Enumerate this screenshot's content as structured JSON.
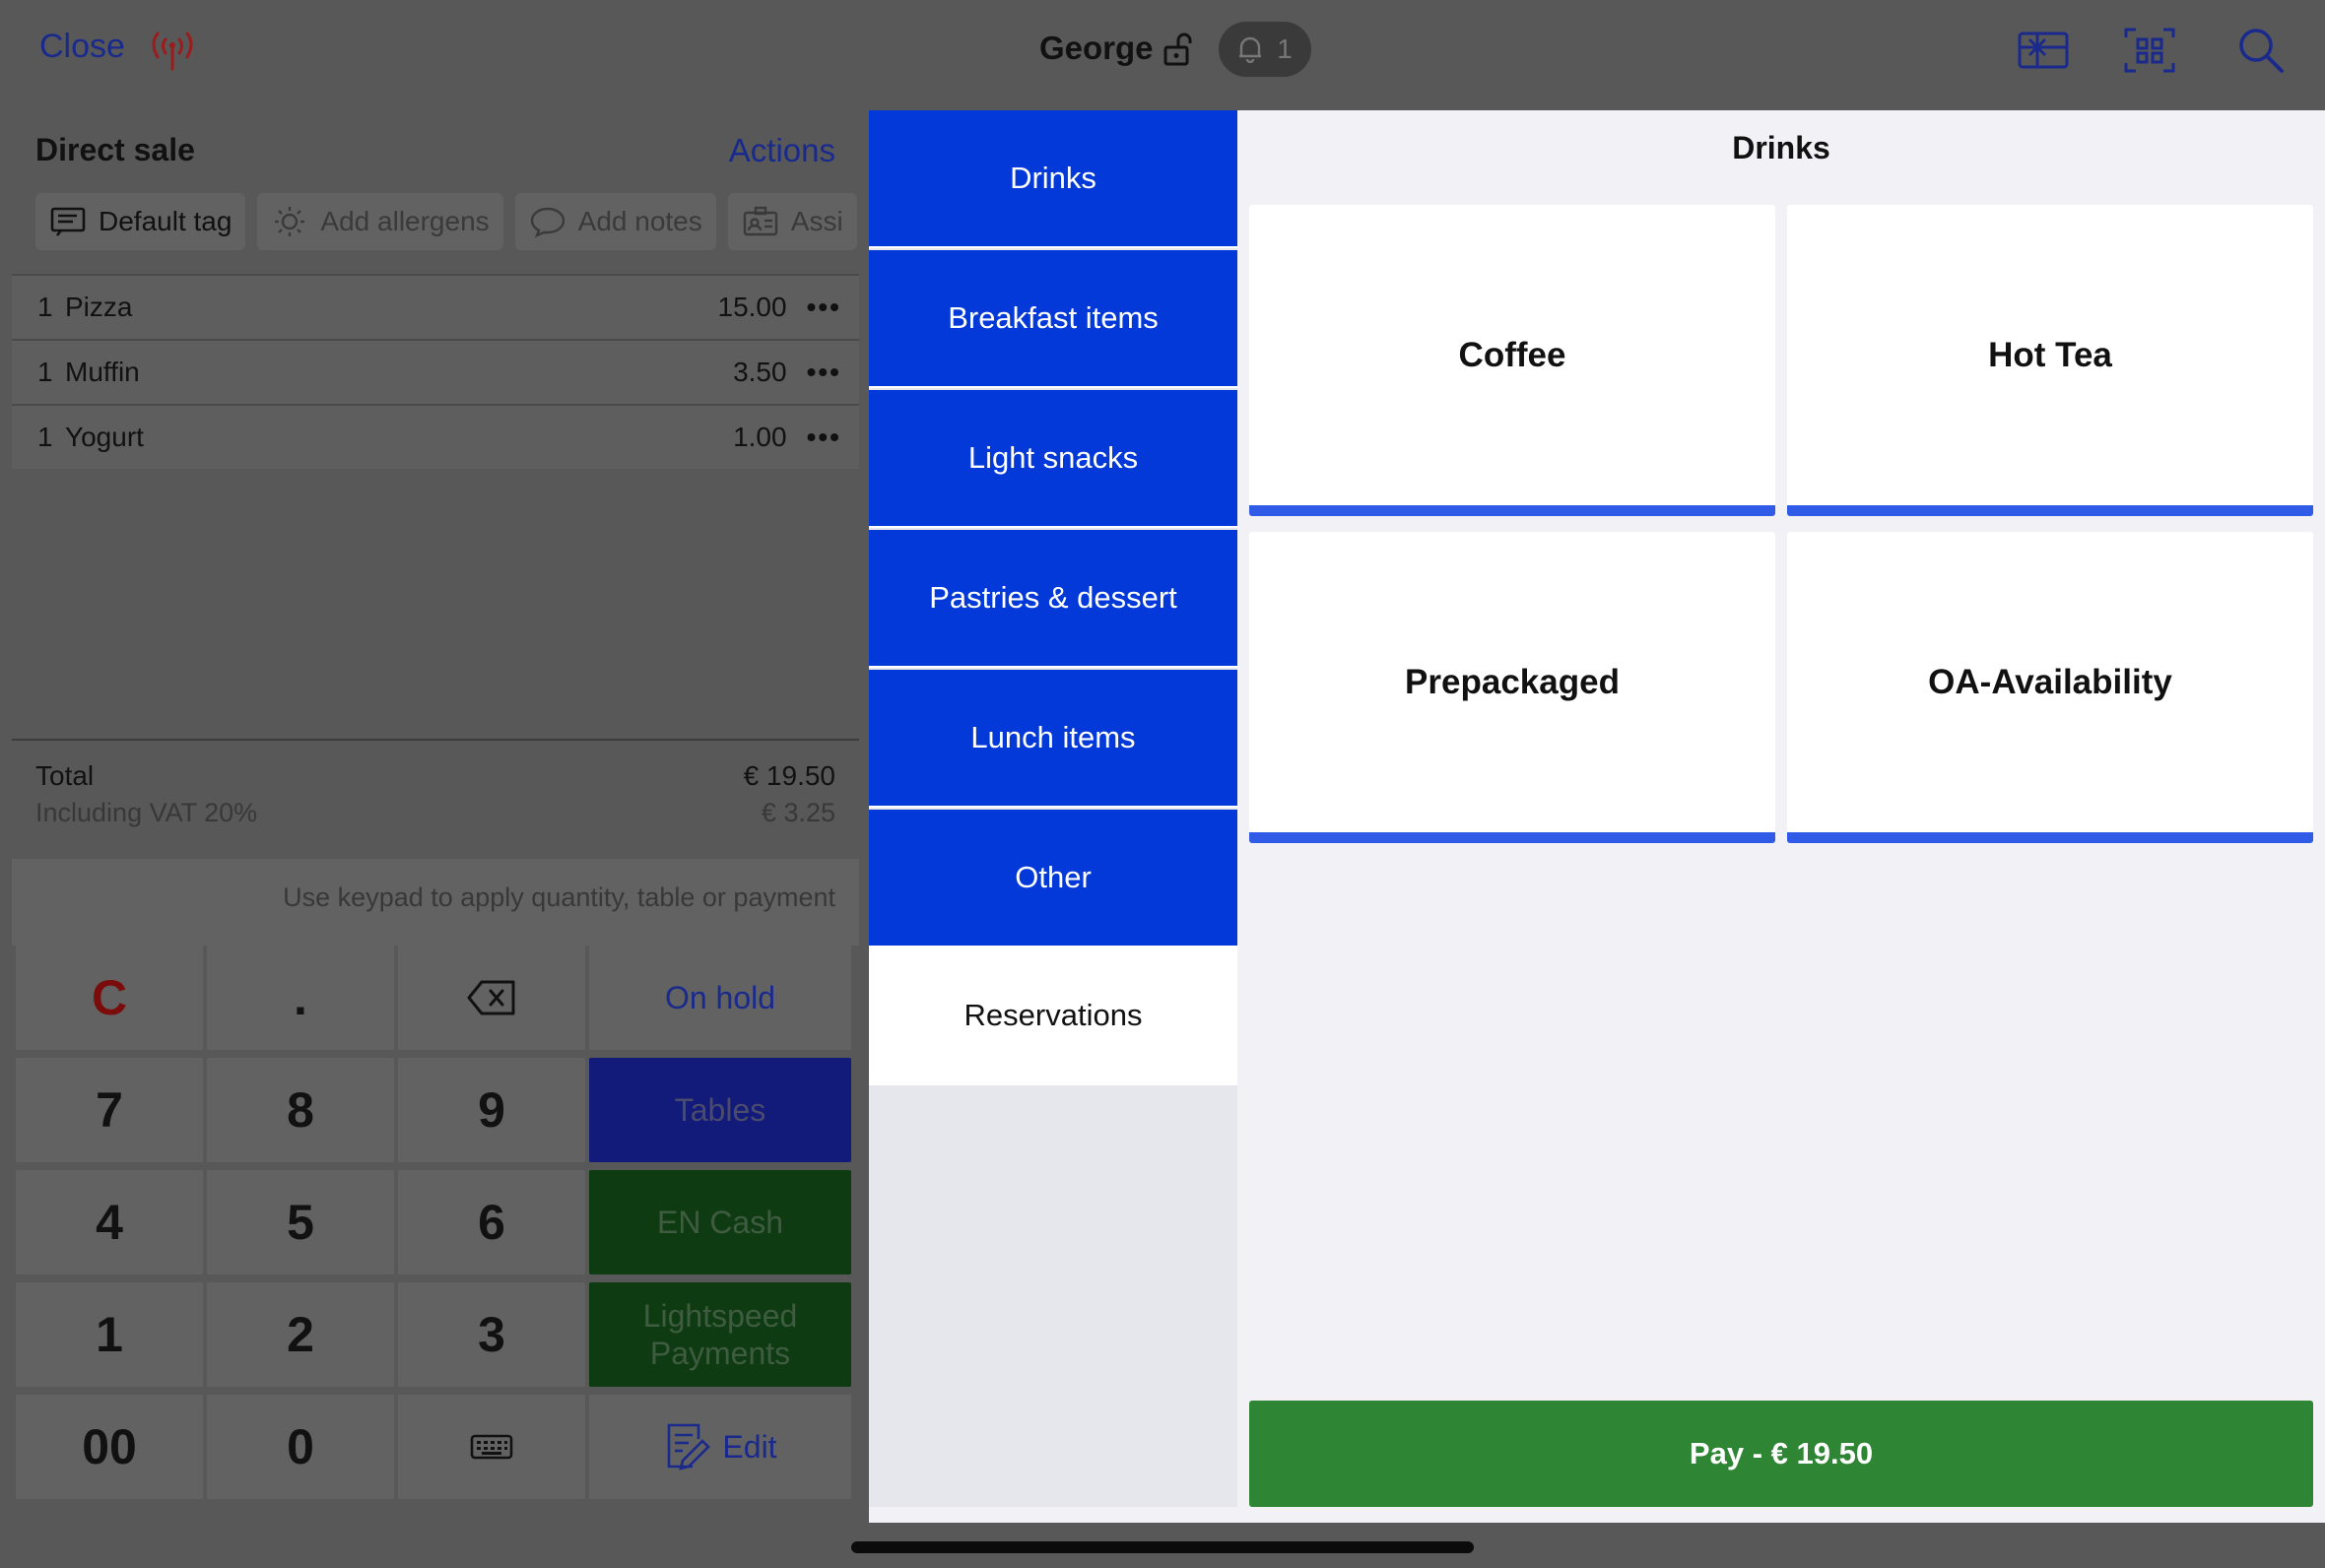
{
  "topbar": {
    "close_label": "Close",
    "user_name": "George",
    "notification_count": "1",
    "icons": [
      "signal-icon",
      "lock-icon",
      "bell-icon",
      "gift-card-icon",
      "qr-scan-icon",
      "search-icon"
    ]
  },
  "order": {
    "title": "Direct sale",
    "actions_label": "Actions",
    "tags": [
      {
        "label": "Default tag",
        "icon": "tag-list-icon"
      },
      {
        "label": "Add allergens",
        "icon": "allergen-icon"
      },
      {
        "label": "Add notes",
        "icon": "speech-bubble-icon"
      },
      {
        "label": "Assi",
        "icon": "assign-icon"
      }
    ],
    "lines": [
      {
        "qty": "1",
        "name": "Pizza",
        "price": "15.00",
        "more": "•••"
      },
      {
        "qty": "1",
        "name": "Muffin",
        "price": "3.50",
        "more": "•••"
      },
      {
        "qty": "1",
        "name": "Yogurt",
        "price": "1.00",
        "more": "•••"
      }
    ],
    "total_label": "Total",
    "total_value": "€ 19.50",
    "vat_label": "Including VAT 20%",
    "vat_value": "€ 3.25",
    "keypad_hint": "Use keypad to apply quantity, table or payment"
  },
  "keypad": {
    "clear": "C",
    "dot": ".",
    "on_hold": "On hold",
    "tables": "Tables",
    "cash": "EN Cash",
    "lightspeed": "Lightspeed Payments",
    "edit": "Edit",
    "digits": [
      "7",
      "8",
      "9",
      "4",
      "5",
      "6",
      "1",
      "2",
      "3",
      "00",
      "0"
    ]
  },
  "menu": {
    "title": "Drinks",
    "categories": [
      {
        "label": "Drinks",
        "selected": true
      },
      {
        "label": "Breakfast items"
      },
      {
        "label": "Light snacks"
      },
      {
        "label": "Pastries & dessert"
      },
      {
        "label": "Lunch items"
      },
      {
        "label": "Other"
      },
      {
        "label": "Reservations"
      }
    ],
    "tiles": [
      "Coffee",
      "Hot Tea",
      "Prepackaged",
      "OA-Availability"
    ],
    "pay_label": "Pay - € 19.50"
  },
  "colors": {
    "category_blue": "#0339d8",
    "tile_accent": "#2f5be6",
    "pay_green": "#2e8533",
    "link_blue": "#1a2a8c"
  }
}
